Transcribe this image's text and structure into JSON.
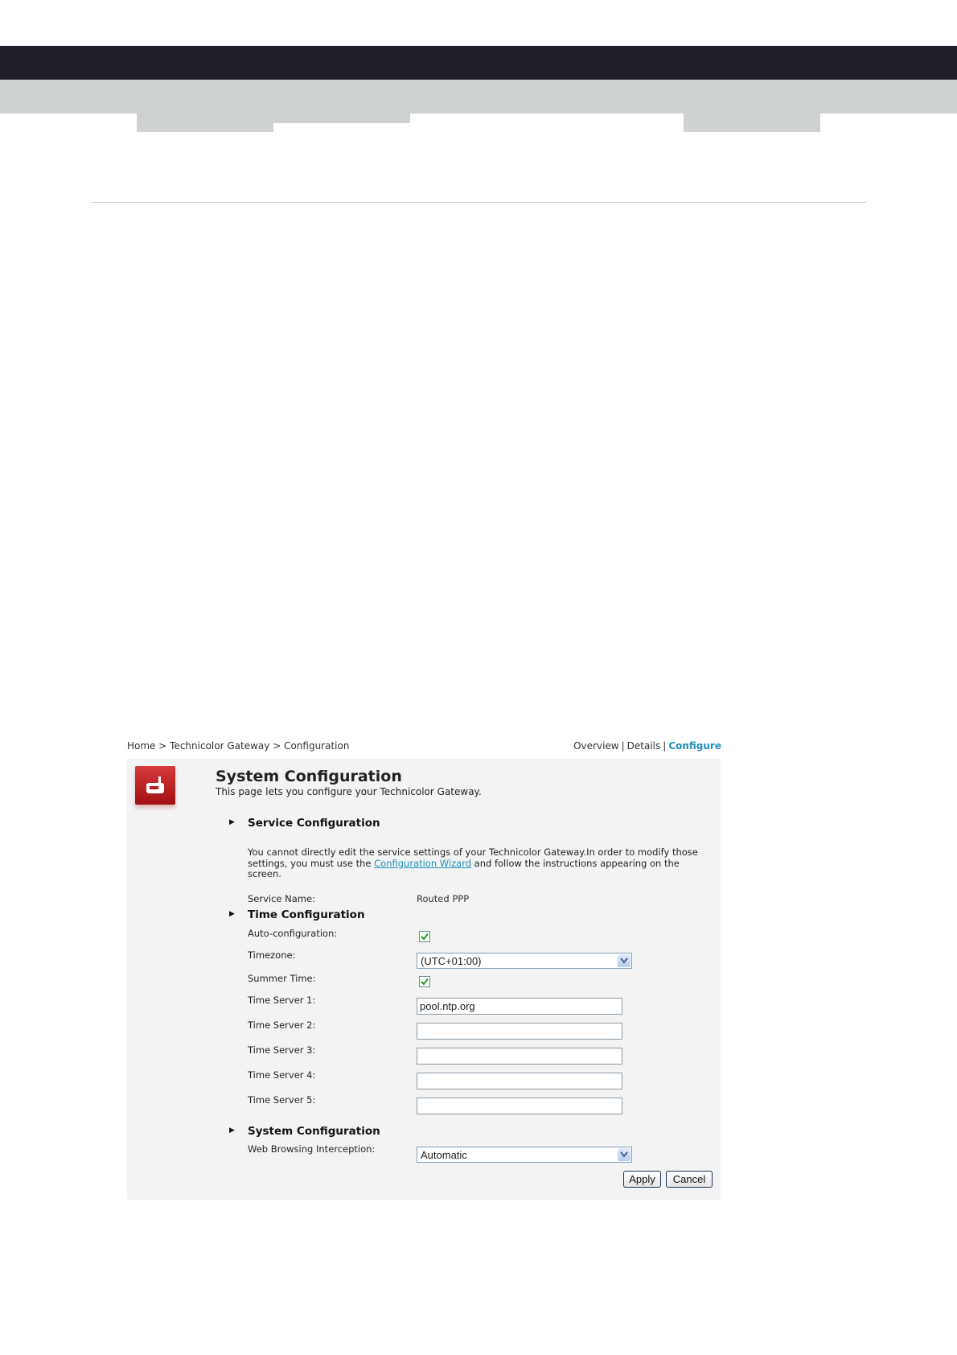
{
  "breadcrumb": {
    "home": "Home",
    "sep": ">",
    "gateway": "Technicolor Gateway",
    "page": "Configuration"
  },
  "views": {
    "overview": "Overview",
    "details": "Details",
    "configure": "Configure",
    "sep": "|"
  },
  "page": {
    "icon": "gateway-icon",
    "title": "System Configuration",
    "subtitle": "This page lets you configure your Technicolor Gateway."
  },
  "service": {
    "heading": "Service Configuration",
    "text_before": "You cannot directly edit the service settings of your Technicolor Gateway.In order to modify those settings, you must use the ",
    "link": "Configuration Wizard",
    "text_after": " and follow the instructions appearing on the screen.",
    "name_label": "Service Name:",
    "name_value": "Routed PPP"
  },
  "time": {
    "heading": "Time Configuration",
    "auto_label": "Auto-configuration:",
    "auto_checked": true,
    "timezone_label": "Timezone:",
    "timezone_value": "(UTC+01:00)",
    "summer_label": "Summer Time:",
    "summer_checked": true,
    "servers": [
      {
        "label": "Time Server 1:",
        "value": "pool.ntp.org"
      },
      {
        "label": "Time Server 2:",
        "value": ""
      },
      {
        "label": "Time Server 3:",
        "value": ""
      },
      {
        "label": "Time Server 4:",
        "value": ""
      },
      {
        "label": "Time Server 5:",
        "value": ""
      }
    ]
  },
  "system": {
    "heading": "System Configuration",
    "web_label": "Web Browsing Interception:",
    "web_value": "Automatic"
  },
  "buttons": {
    "apply": "Apply",
    "cancel": "Cancel"
  },
  "colors": {
    "accent": "#1f8fb8",
    "icon_red": "#c62828",
    "header_dark": "#1f2029",
    "header_grey": "#cdd1d2",
    "panel_bg": "#f3f3f3"
  }
}
